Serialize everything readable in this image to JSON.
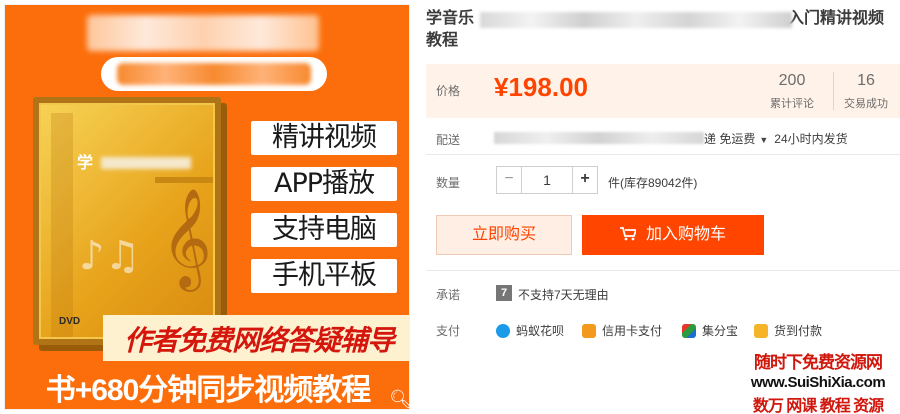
{
  "product_image": {
    "features": [
      "精讲视频",
      "APP播放",
      "支持电脑",
      "手机平板"
    ],
    "support_text": "作者免费网络答疑辅导",
    "bottom_text": "书+680分钟同步视频教程",
    "dvd_title": "学",
    "dvd_logo": "DVD"
  },
  "title": {
    "prefix": "学音乐",
    "suffix": "入门精讲视频",
    "line2": "教程"
  },
  "price": {
    "label": "价格",
    "value": "¥198.00",
    "reviews_count": "200",
    "reviews_label": "累计评论",
    "sales_count": "16",
    "sales_label": "交易成功"
  },
  "delivery": {
    "label": "配送",
    "tail_text": "递 免运费",
    "ship_time": "24小时内发货"
  },
  "quantity": {
    "label": "数量",
    "value": "1",
    "minus": "−",
    "plus": "+",
    "stock": "件(库存89042件)"
  },
  "actions": {
    "buy_now": "立即购买",
    "add_to_cart": "加入购物车"
  },
  "promise": {
    "label": "承诺",
    "icon_text": "7",
    "text": "不支持7天无理由"
  },
  "payment": {
    "label": "支付",
    "methods": [
      "蚂蚁花呗",
      "信用卡支付",
      "集分宝",
      "货到付款"
    ]
  },
  "watermark": {
    "line1": "随时下免费资源网",
    "line2": "www.SuiShiXia.com",
    "line3": "数万 网课 教程 资源"
  },
  "colors": {
    "accent": "#ff4400",
    "price_bg": "#fff2e8",
    "image_bg": "#fb6e0b"
  }
}
